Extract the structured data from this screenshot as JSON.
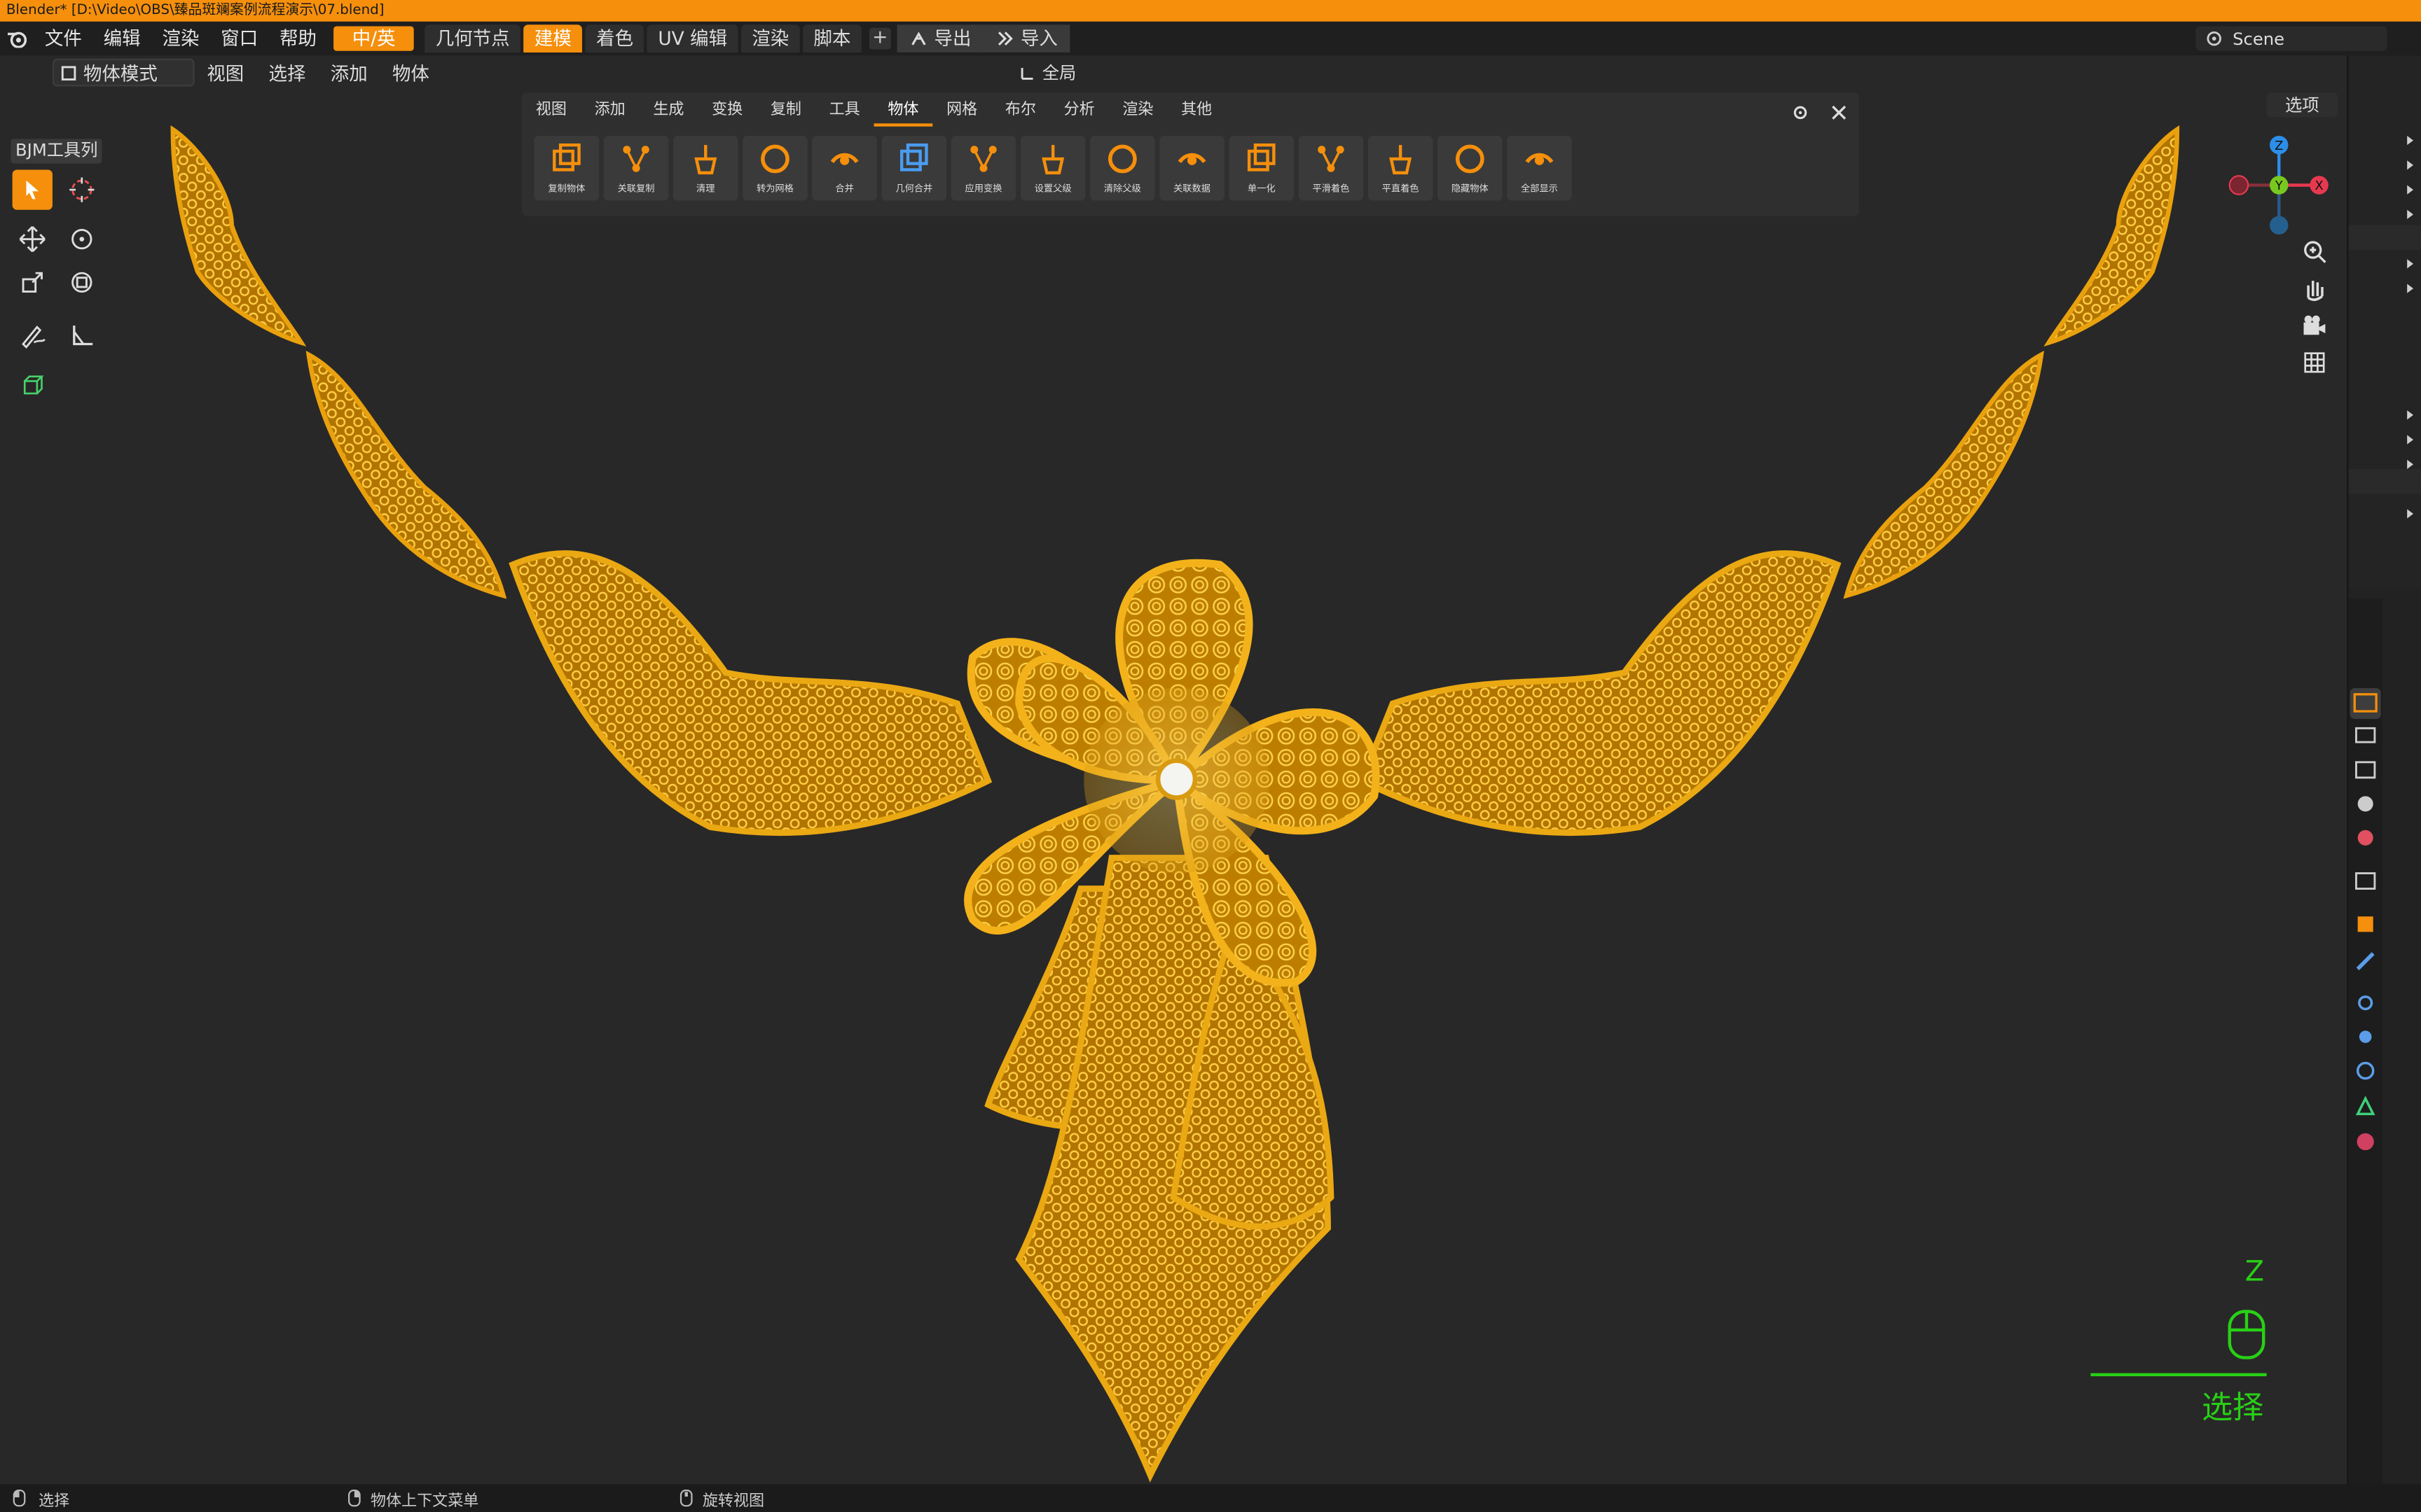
{
  "titlebar": {
    "text": "Blender* [D:\\Video\\OBS\\臻品斑斓案例流程演示\\07.blend]"
  },
  "menu": {
    "file": "文件",
    "edit": "编辑",
    "render": "渲染",
    "window": "窗口",
    "help": "帮助",
    "lang": "中/英"
  },
  "workspaces": {
    "geometry_nodes": "几何节点",
    "modeling": "建模",
    "shading": "着色",
    "uv_editing": "UV 编辑",
    "rendering": "渲染",
    "scripting": "脚本",
    "add": "+"
  },
  "io": {
    "export": "导出",
    "import": "导入"
  },
  "scene": {
    "name": "Scene"
  },
  "viewport": {
    "mode": "物体模式",
    "menus": {
      "view": "视图",
      "select": "选择",
      "add": "添加",
      "object": "物体"
    },
    "orientation": "全局",
    "options": "选项"
  },
  "toolbar": {
    "title": "BJM工具列"
  },
  "toolbox": {
    "tabs": [
      "视图",
      "添加",
      "生成",
      "变换",
      "复制",
      "工具",
      "物体",
      "网格",
      "布尔",
      "分析",
      "渲染",
      "其他"
    ],
    "active_tab": "物体",
    "buttons": [
      "复制物体",
      "关联复制",
      "清理",
      "转为网格",
      "合并",
      "几何合并",
      "应用变换",
      "设置父级",
      "清除父级",
      "关联数据",
      "单一化",
      "平滑着色",
      "平直着色",
      "隐藏物体",
      "全部显示"
    ]
  },
  "gizmo": {
    "x": "X",
    "y": "Y",
    "z": "Z"
  },
  "key_overlay": {
    "key": "Z",
    "action": "选择"
  },
  "statusbar": {
    "select": "选择",
    "context_menu": "物体上下文菜单",
    "rotate_view": "旋转视图"
  },
  "colors": {
    "accent": "#f58f0c",
    "gold": "#f2b019",
    "gold_dark": "#8a5a00",
    "overlay_green": "#28d016"
  }
}
